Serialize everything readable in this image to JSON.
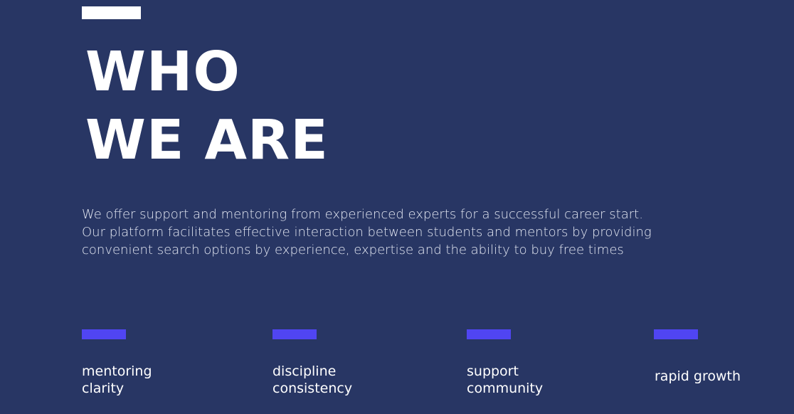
{
  "hero": {
    "title_line_1": "WHO",
    "title_line_2": "WE ARE",
    "description_lines": [
      "We offer support and mentoring from experienced experts for a successful career start.",
      "Our platform facilitates effective interaction between students and mentors by providing",
      "convenient search options by experience, expertise and the ability to buy free times"
    ]
  },
  "values": [
    {
      "line_1": "mentoring",
      "line_2": "clarity"
    },
    {
      "line_1": "discipline",
      "line_2": "consistency"
    },
    {
      "line_1": "support",
      "line_2": "community"
    },
    {
      "line_1": "rapid growth"
    }
  ],
  "colors": {
    "background": "#283664",
    "accent": "#5045f2",
    "text": "#ffffff"
  }
}
